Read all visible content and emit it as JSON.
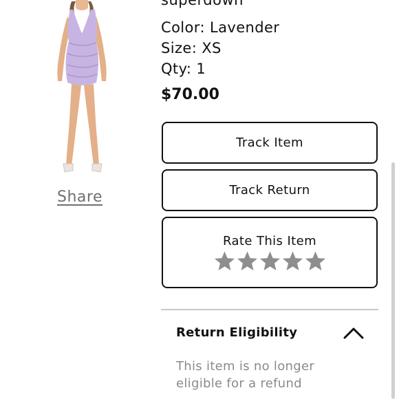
{
  "product": {
    "brand": "superdown",
    "color": "Color: Lavender",
    "size": "Size: XS",
    "qty": "Qty: 1",
    "price": "$70.00",
    "dress_color": "#c7b4e2"
  },
  "share": {
    "label": "Share"
  },
  "actions": {
    "track_item": "Track Item",
    "track_return": "Track Return",
    "rate_label": "Rate This Item",
    "star_color": "#8e8e8e",
    "star_count": 5
  },
  "return_eligibility": {
    "title": "Return Eligibility",
    "description": "This item is no longer eligible for a refund",
    "icon": "chevron-up-icon"
  }
}
